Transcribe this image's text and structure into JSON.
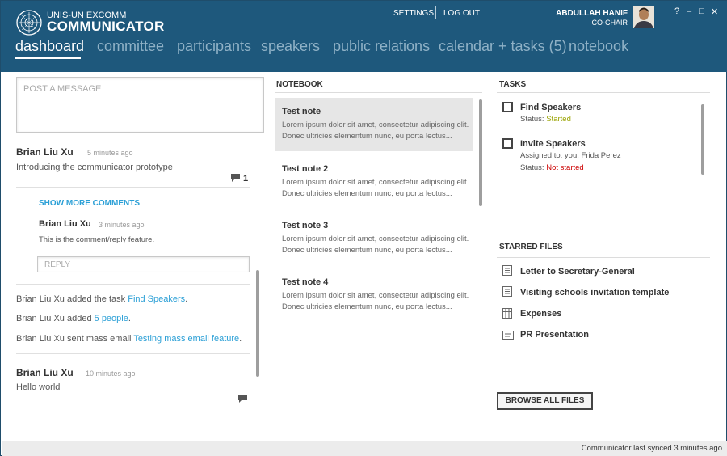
{
  "app": {
    "org": "UNIS-UN EXCOMM",
    "title": "COMMUNICATOR"
  },
  "header": {
    "settings_label": "SETTINGS",
    "logout_label": "LOG OUT",
    "user_name": "ABDULLAH HANIF",
    "user_role": "CO-CHAIR",
    "help_label": "?",
    "minimize_label": "–",
    "maximize_label": "□",
    "close_label": "✕"
  },
  "nav": {
    "items": [
      "dashboard",
      "committee",
      "participants",
      "speakers",
      "public relations",
      "calendar + tasks (5)",
      "notebook"
    ],
    "active": "dashboard"
  },
  "feed": {
    "post_placeholder": "POST A MESSAGE",
    "post1": {
      "author": "Brian Liu Xu",
      "time": "5 minutes ago",
      "text": "Introducing the communicator prototype",
      "comment_count": "1"
    },
    "show_more": "SHOW MORE COMMENTS",
    "comment": {
      "author": "Brian Liu Xu",
      "time": "3 minutes ago",
      "text": "This is the comment/reply feature."
    },
    "reply_placeholder": "REPLY",
    "activities": [
      {
        "prefix": "Brian Liu Xu added the task ",
        "link": "Find Speakers",
        "suffix": "."
      },
      {
        "prefix": "Brian Liu Xu added ",
        "link": "5 people",
        "suffix": "."
      },
      {
        "prefix": "Brian Liu Xu sent mass email ",
        "link": "Testing mass email feature",
        "suffix": "."
      }
    ],
    "post2": {
      "author": "Brian Liu Xu",
      "time": "10 minutes ago",
      "text": "Hello world"
    }
  },
  "notebook": {
    "title": "NOTEBOOK",
    "notes": [
      {
        "title": "Test note",
        "body": "Lorem ipsum dolor sit amet, consectetur adipiscing elit. Donec ultricies elementum nunc, eu porta lectus..."
      },
      {
        "title": "Test note 2",
        "body": "Lorem ipsum dolor sit amet, consectetur adipiscing elit. Donec ultricies elementum nunc, eu porta lectus..."
      },
      {
        "title": "Test note 3",
        "body": "Lorem ipsum dolor sit amet, consectetur adipiscing elit. Donec ultricies elementum nunc, eu porta lectus..."
      },
      {
        "title": "Test note 4",
        "body": "Lorem ipsum dolor sit amet, consectetur adipiscing elit. Donec ultricies elementum nunc, eu porta lectus..."
      }
    ]
  },
  "tasks": {
    "title": "TASKS",
    "items": [
      {
        "title": "Find Speakers",
        "status_label": "Status: ",
        "status": "Started"
      },
      {
        "title": "Invite Speakers",
        "assigned_label": "Assigned to: ",
        "assigned": "you, Frida Perez",
        "status_label": "Status: ",
        "status": "Not started"
      }
    ]
  },
  "files": {
    "title": "STARRED FILES",
    "items": [
      {
        "name": "Letter to Secretary-General",
        "icon": "document-icon"
      },
      {
        "name": "Visiting schools invitation template",
        "icon": "document-icon"
      },
      {
        "name": "Expenses",
        "icon": "spreadsheet-icon"
      },
      {
        "name": "PR Presentation",
        "icon": "presentation-icon"
      }
    ],
    "browse_label": "BROWSE ALL FILES"
  },
  "status_bar": {
    "text": "Communicator last synced 3 minutes ago"
  },
  "colors": {
    "header_bg": "#1e587c",
    "link": "#2a9fd6",
    "status_started": "#9aa300",
    "status_not_started": "#cc0000"
  }
}
